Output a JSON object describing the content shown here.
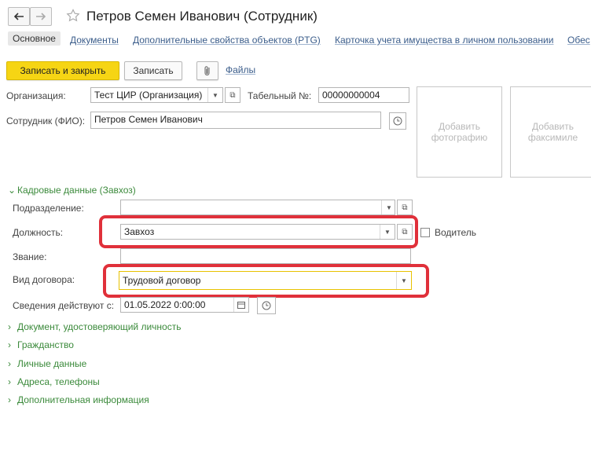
{
  "window": {
    "title": "Петров Семен Иванович (Сотрудник)"
  },
  "tabs": [
    {
      "label": "Основное"
    },
    {
      "label": "Документы"
    },
    {
      "label": "Дополнительные свойства объектов (PTG)"
    },
    {
      "label": "Карточка учета имущества в личном пользовании"
    },
    {
      "label": "Обес"
    }
  ],
  "toolbar": {
    "save_close": "Записать и закрыть",
    "save": "Записать",
    "files": "Файлы"
  },
  "form": {
    "org_label": "Организация:",
    "org_value": "Тест ЦИР (Организация)",
    "tab_label": "Табельный №:",
    "tab_value": "00000000004",
    "fio_label": "Сотрудник (ФИО):",
    "fio_value": "Петров Семен Иванович",
    "photo_text": "Добавить фотографию",
    "facsimile_text": "Добавить факсимиле"
  },
  "hr": {
    "section_title": "Кадровые данные (Завхоз)",
    "dept_label": "Подразделение:",
    "dept_value": "",
    "position_label": "Должность:",
    "position_value": "Завхоз",
    "driver_label": "Водитель",
    "rank_label": "Звание:",
    "rank_value": "",
    "contract_label": "Вид договора:",
    "contract_value": "Трудовой договор",
    "valid_label": "Сведения действуют с:",
    "valid_value": "01.05.2022  0:00:00"
  },
  "sections": [
    {
      "label": "Документ, удостоверяющий личность"
    },
    {
      "label": "Гражданство"
    },
    {
      "label": "Личные данные"
    },
    {
      "label": "Адреса, телефоны"
    },
    {
      "label": "Дополнительная информация"
    }
  ],
  "colors": {
    "accent": "#f6d514",
    "highlight": "#e0303a",
    "section_green": "#3b8a3b"
  }
}
